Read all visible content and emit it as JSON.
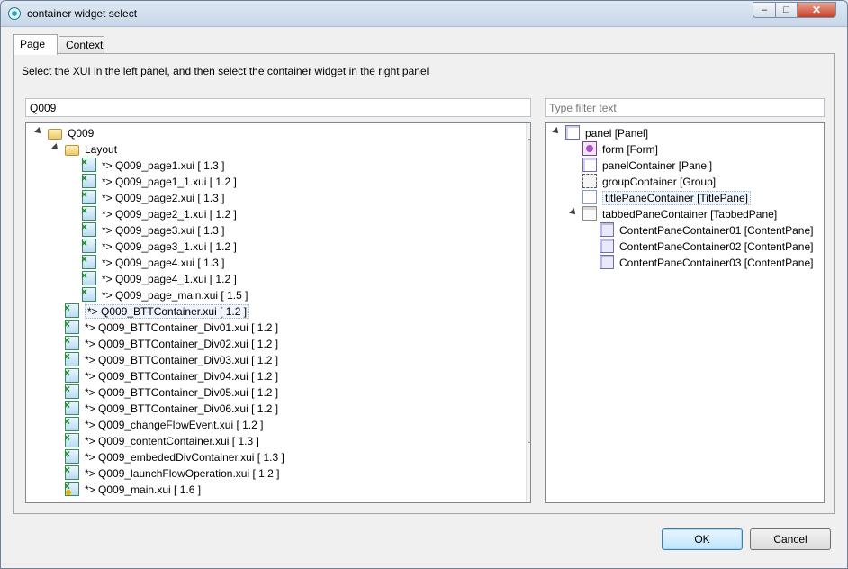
{
  "window": {
    "title": "container widget select",
    "minimize": "‒",
    "maximize": "□",
    "close": "✕"
  },
  "tabs": [
    {
      "label": "Page",
      "active": true
    },
    {
      "label": "Context",
      "active": false
    }
  ],
  "instruction": "Select the XUI in the left panel, and then select the container widget in the right panel",
  "left_filter": {
    "value": "Q009"
  },
  "right_filter": {
    "placeholder": "Type filter text"
  },
  "left_tree": [
    {
      "label": "Q009",
      "icon": "folder-open-icon",
      "level": 0,
      "expanded": true
    },
    {
      "label": "Layout",
      "icon": "folder-open-icon",
      "level": 1,
      "expanded": true
    },
    {
      "label": "*> Q009_page1.xui [ 1.3 ]",
      "icon": "xui-file-icon",
      "level": 2
    },
    {
      "label": "*> Q009_page1_1.xui [ 1.2 ]",
      "icon": "xui-file-icon",
      "level": 2
    },
    {
      "label": "*> Q009_page2.xui [ 1.3 ]",
      "icon": "xui-file-icon",
      "level": 2
    },
    {
      "label": "*> Q009_page2_1.xui [ 1.2 ]",
      "icon": "xui-file-icon",
      "level": 2
    },
    {
      "label": "*> Q009_page3.xui [ 1.3 ]",
      "icon": "xui-file-icon",
      "level": 2
    },
    {
      "label": "*> Q009_page3_1.xui [ 1.2 ]",
      "icon": "xui-file-icon",
      "level": 2
    },
    {
      "label": "*> Q009_page4.xui [ 1.3 ]",
      "icon": "xui-file-icon",
      "level": 2
    },
    {
      "label": "*> Q009_page4_1.xui [ 1.2 ]",
      "icon": "xui-file-icon",
      "level": 2
    },
    {
      "label": "*> Q009_page_main.xui [ 1.5 ]",
      "icon": "xui-file-icon",
      "level": 2
    },
    {
      "label": "*> Q009_BTTContainer.xui [ 1.2 ]",
      "icon": "xui-file-icon",
      "level": 1,
      "selected": true
    },
    {
      "label": "*> Q009_BTTContainer_Div01.xui [ 1.2 ]",
      "icon": "xui-file-icon",
      "level": 1
    },
    {
      "label": "*> Q009_BTTContainer_Div02.xui [ 1.2 ]",
      "icon": "xui-file-icon",
      "level": 1
    },
    {
      "label": "*> Q009_BTTContainer_Div03.xui [ 1.2 ]",
      "icon": "xui-file-icon",
      "level": 1
    },
    {
      "label": "*> Q009_BTTContainer_Div04.xui [ 1.2 ]",
      "icon": "xui-file-icon",
      "level": 1
    },
    {
      "label": "*> Q009_BTTContainer_Div05.xui [ 1.2 ]",
      "icon": "xui-file-icon",
      "level": 1
    },
    {
      "label": "*> Q009_BTTContainer_Div06.xui [ 1.2 ]",
      "icon": "xui-file-icon",
      "level": 1
    },
    {
      "label": "*> Q009_changeFlowEvent.xui [ 1.2 ]",
      "icon": "xui-file-icon",
      "level": 1
    },
    {
      "label": "*> Q009_contentContainer.xui [ 1.3 ]",
      "icon": "xui-file-icon",
      "level": 1
    },
    {
      "label": "*> Q009_embededDivContainer.xui [ 1.3 ]",
      "icon": "xui-file-icon",
      "level": 1
    },
    {
      "label": "*> Q009_launchFlowOperation.xui [ 1.2 ]",
      "icon": "xui-file-icon",
      "level": 1
    },
    {
      "label": "*> Q009_main.xui [ 1.6 ]",
      "icon": "xui-main-file-icon",
      "level": 1
    }
  ],
  "right_tree": [
    {
      "label": "panel [Panel]",
      "icon": "panel-icon",
      "level": 0,
      "expanded": true
    },
    {
      "label": "form [Form]",
      "icon": "form-icon",
      "level": 1
    },
    {
      "label": "panelContainer [Panel]",
      "icon": "panel-icon",
      "level": 1
    },
    {
      "label": "groupContainer [Group]",
      "icon": "group-icon",
      "level": 1
    },
    {
      "label": "titlePaneContainer [TitlePane]",
      "icon": "titlepane-icon",
      "level": 1,
      "selected": true
    },
    {
      "label": "tabbedPaneContainer [TabbedPane]",
      "icon": "tabbedpane-icon",
      "level": 1,
      "expanded": true
    },
    {
      "label": "ContentPaneContainer01 [ContentPane]",
      "icon": "contentpane-icon",
      "level": 2
    },
    {
      "label": "ContentPaneContainer02 [ContentPane]",
      "icon": "contentpane-icon",
      "level": 2
    },
    {
      "label": "ContentPaneContainer03 [ContentPane]",
      "icon": "contentpane-icon",
      "level": 2
    }
  ],
  "buttons": {
    "ok": "OK",
    "cancel": "Cancel"
  },
  "colors": {
    "accent": "#3c7fb1",
    "selection": "#eef5fc"
  }
}
